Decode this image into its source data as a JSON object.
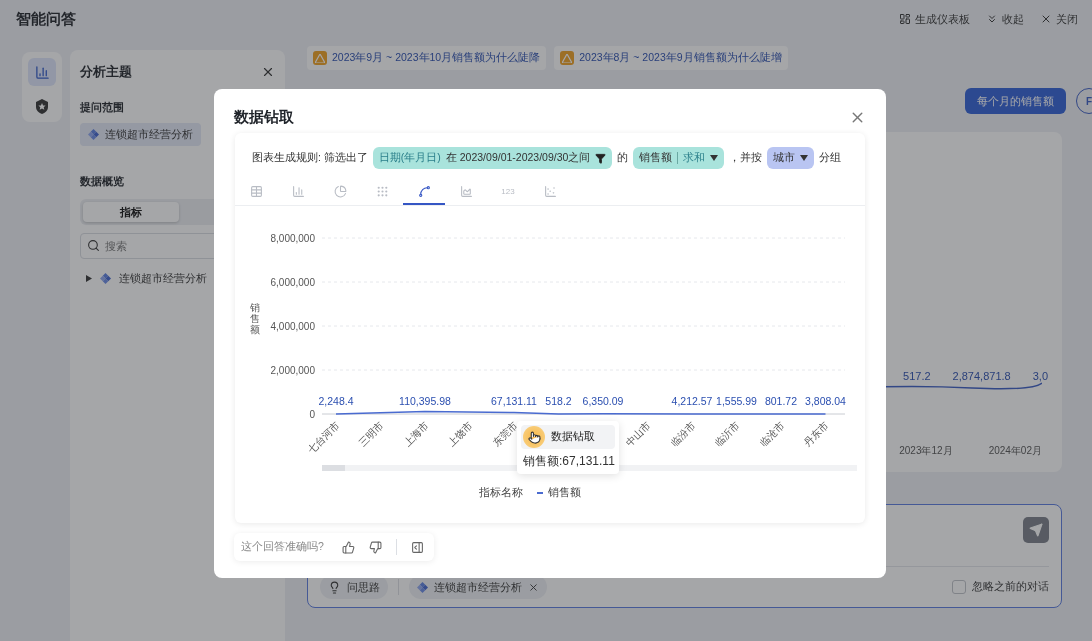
{
  "app": {
    "title": "智能问答",
    "actions": [
      {
        "label": "生成仪表板",
        "kind": "dashboard"
      },
      {
        "label": "收起",
        "kind": "collapse"
      },
      {
        "label": "关闭",
        "kind": "close"
      }
    ]
  },
  "rail": [
    {
      "kind": "chart",
      "selected": true
    },
    {
      "kind": "star",
      "selected": false
    }
  ],
  "sidebar": {
    "title": "分析主题",
    "scope_label": "提问范围",
    "scope_chip": "连锁超市经营分析",
    "overview_label": "数据概览",
    "tabs": [
      {
        "label": "指标",
        "selected": true
      }
    ],
    "search": {
      "placeholder": "搜索"
    },
    "tree": [
      {
        "label": "连锁超市经营分析",
        "expanded": false
      }
    ]
  },
  "suggestions": [
    "2023年9月 ~ 2023年10月销售额为什么陡降",
    "2023年8月 ~ 2023年9月销售额为什么陡增"
  ],
  "query_button": "每个月的销售额",
  "avatar": "F",
  "background_chart": {
    "value_labels": [
      "517.2",
      "2,874,871.8",
      "3,0"
    ],
    "x_labels": [
      "2023年12月",
      "2024年02月"
    ]
  },
  "composer": {
    "chips": [
      {
        "label": "问思路",
        "kind": "idea",
        "removable": false
      },
      {
        "label": "连锁超市经营分析",
        "kind": "topic",
        "removable": true
      }
    ],
    "ignore_history": {
      "label": "忽略之前的对话",
      "checked": false
    }
  },
  "dialog": {
    "title": "数据钻取",
    "rule": {
      "prefix": "图表生成规则: 筛选出了",
      "filter": {
        "field": "日期(年月日)",
        "text": "在 2023/09/01-2023/09/30之间"
      },
      "of": "的",
      "measure": {
        "field": "销售额",
        "agg": "求和"
      },
      "group_prefix": "，并按",
      "group": "城市",
      "suffix": "分组"
    },
    "chart_types": [
      {
        "kind": "table",
        "selected": false
      },
      {
        "kind": "bar",
        "selected": false
      },
      {
        "kind": "pie",
        "selected": false
      },
      {
        "kind": "dots",
        "selected": false
      },
      {
        "kind": "line",
        "selected": true
      },
      {
        "kind": "area",
        "selected": false
      },
      {
        "kind": "number",
        "label": "123",
        "selected": false
      },
      {
        "kind": "scatter",
        "selected": false
      }
    ],
    "chart_data": {
      "type": "line",
      "ylabel": "销售额",
      "categories": [
        "七台河市",
        "三明市",
        "上海市",
        "上饶市",
        "东莞市",
        null,
        null,
        "中山市",
        "临汾市",
        "临沂市",
        "临沧市",
        "丹东市"
      ],
      "series": [
        {
          "name": "销售额",
          "color": "#4a6bd0",
          "values": [
            2248.4,
            null,
            110395.98,
            null,
            67131.11,
            518.2,
            6350.09,
            null,
            4212.57,
            1555.99,
            801.72,
            3808.04
          ]
        }
      ],
      "value_labels": [
        "2,248.4",
        null,
        "110,395.98",
        null,
        "67,131.11",
        "518.2",
        "6,350.09",
        null,
        "4,212.57",
        "1,555.99",
        "801.72",
        "3,808.04"
      ],
      "ylim": [
        0,
        8000000
      ],
      "grid": true,
      "yticks": [
        {
          "value": 0,
          "label": "0"
        },
        {
          "value": 2000000,
          "label": "2,000,000"
        },
        {
          "value": 4000000,
          "label": "4,000,000"
        },
        {
          "value": 6000000,
          "label": "6,000,000"
        },
        {
          "value": 8000000,
          "label": "8,000,000"
        }
      ]
    },
    "legend_title": "指标名称",
    "tooltip": {
      "action": "数据钻取",
      "reading": "销售额:67,131.11"
    },
    "feedback": {
      "question": "这个回答准确吗?"
    }
  }
}
